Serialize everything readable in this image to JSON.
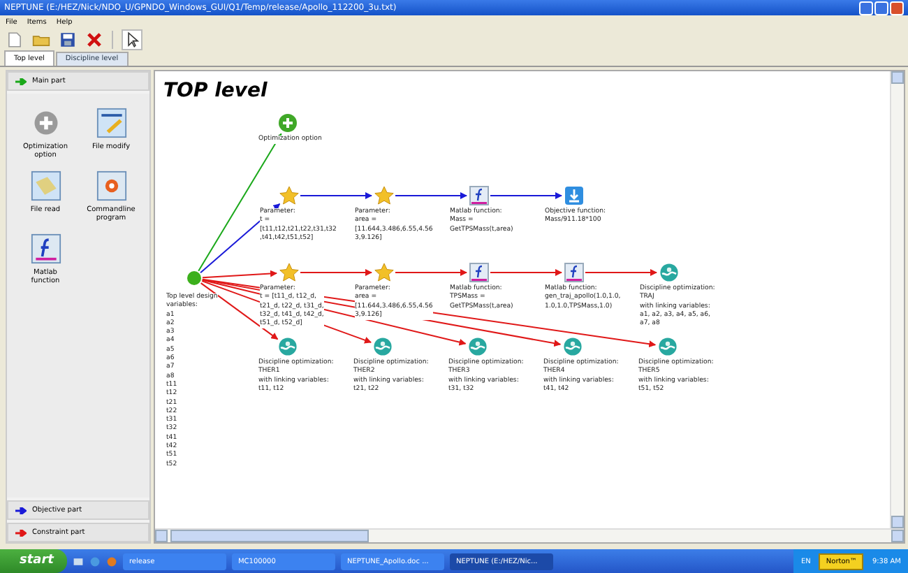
{
  "window": {
    "title": "NEPTUNE (E:/HEZ/Nick/NDO_U/GPNDO_Windows_GUI/Q1/Temp/release/Apollo_112200_3u.txt)"
  },
  "menu": [
    "File",
    "Items",
    "Help"
  ],
  "tabs": [
    {
      "label": "Top level",
      "selected": true
    },
    {
      "label": "Discipline level",
      "selected": false
    }
  ],
  "sidebar": {
    "header": {
      "label": "Main part",
      "color": "#1aa81a"
    },
    "items": [
      {
        "kind": "option",
        "label": "Optimization\noption"
      },
      {
        "kind": "modify",
        "label": "File modify"
      },
      {
        "kind": "read",
        "label": "File read"
      },
      {
        "kind": "command",
        "label": "Commandline\nprogram"
      },
      {
        "kind": "matlab",
        "label": "Matlab\nfunction"
      }
    ],
    "legend": [
      {
        "label": "Objective part",
        "color": "#1a1ad8"
      },
      {
        "label": "Constraint part",
        "color": "#e01818"
      }
    ]
  },
  "canvas": {
    "title": "TOP level",
    "option": {
      "kind": "option",
      "label": "Optimization option"
    },
    "design_variables": {
      "label": "Top level design\nvariables:\na1\na2\na3\na4\na5\na6\na7\na8\nt11\nt12\nt21\nt22\nt31\nt32\nt41\nt42\nt51\nt52"
    },
    "objective_chain": [
      {
        "kind": "parameter",
        "label": "Parameter:\nt =\n[t11,t12,t21,t22,t31,t32\n,t41,t42,t51,t52]"
      },
      {
        "kind": "parameter",
        "label": "Parameter:\narea =\n[11.644,3.486,6.55,4.56\n3,9.126]"
      },
      {
        "kind": "matlab",
        "label": "Matlab function:\nMass =\nGetTPSMass(t,area)"
      },
      {
        "kind": "objective",
        "label": "Objective function:\nMass/911.18*100"
      }
    ],
    "constraint_chain": [
      {
        "kind": "parameter",
        "label": "Parameter:\nt = [t11_d, t12_d,\nt21_d, t22_d, t31_d,\nt32_d, t41_d, t42_d,\nt51_d, t52_d]"
      },
      {
        "kind": "parameter",
        "label": "Parameter:\narea =\n[11.644,3.486,6.55,4.56\n3,9.126]"
      },
      {
        "kind": "matlab",
        "label": "Matlab function:\nTPSMass =\nGetTPSMass(t,area)"
      },
      {
        "kind": "matlab",
        "label": "Matlab function:\ngen_traj_apollo(1.0,1.0,\n1.0,1.0,TPSMass,1.0)"
      },
      {
        "kind": "discipline",
        "label": "Discipline optimization:\nTRAJ\nwith linking variables:\na1, a2, a3, a4, a5, a6,\na7, a8"
      }
    ],
    "disciplines": [
      {
        "kind": "discipline",
        "label": "Discipline optimization:\nTHER1\nwith linking variables:\nt11, t12"
      },
      {
        "kind": "discipline",
        "label": "Discipline optimization:\nTHER2\nwith linking variables:\nt21, t22"
      },
      {
        "kind": "discipline",
        "label": "Discipline optimization:\nTHER3\nwith linking variables:\nt31, t32"
      },
      {
        "kind": "discipline",
        "label": "Discipline optimization:\nTHER4\nwith linking variables:\nt41, t42"
      },
      {
        "kind": "discipline",
        "label": "Discipline optimization:\nTHER5\nwith linking variables:\nt51, t52"
      }
    ]
  },
  "taskbar": {
    "start": "start",
    "windows": [
      {
        "label": "release",
        "selected": false
      },
      {
        "label": "MC100000",
        "selected": false
      },
      {
        "label": "NEPTUNE_Apollo.doc ...",
        "selected": false
      },
      {
        "label": "NEPTUNE (E:/HEZ/Nic...",
        "selected": true
      }
    ],
    "tray": {
      "language": "EN",
      "antivirus": "Norton™",
      "clock": "9:38 AM"
    }
  }
}
